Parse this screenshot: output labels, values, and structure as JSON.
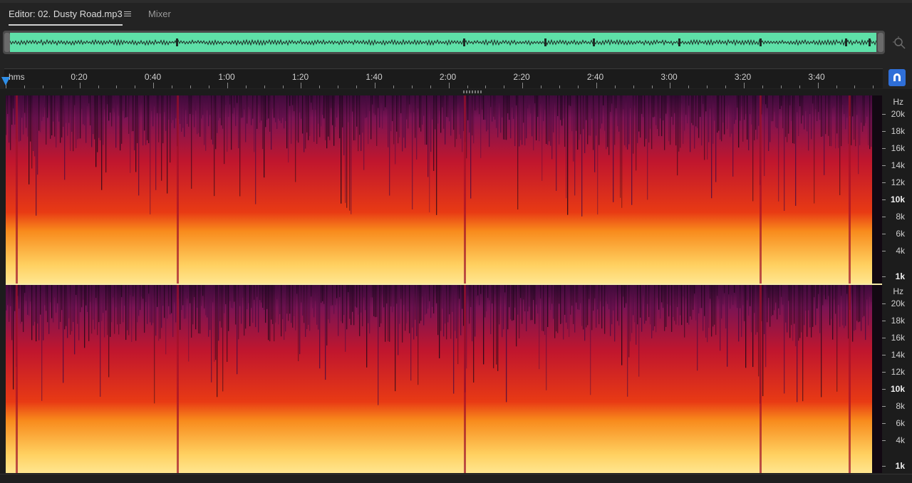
{
  "tabs": {
    "editor_label": "Editor: 02. Dusty Road.mp3",
    "mixer_label": "Mixer"
  },
  "ruler": {
    "unit": "hms",
    "labels": [
      "0:20",
      "0:40",
      "1:00",
      "1:20",
      "1:40",
      "2:00",
      "2:20",
      "2:40",
      "3:00",
      "3:20",
      "3:40"
    ]
  },
  "frequency_scale": {
    "unit": "Hz",
    "labels": [
      "20k",
      "18k",
      "16k",
      "14k",
      "12k",
      "10k",
      "8k",
      "6k",
      "4k",
      "1k"
    ]
  },
  "colors": {
    "overview_waveform_bg": "#5ee0a8",
    "spectral_low": "#2a0a2e",
    "spectral_mid": "#b01a3a",
    "spectral_high": "#ffdd66",
    "accent": "#2e8ee8"
  },
  "icons": {
    "tab_menu": "hamburger-menu-icon",
    "zoom": "zoom-in-icon",
    "snap": "magnet-snap-icon",
    "playhead": "playhead-marker-icon"
  }
}
